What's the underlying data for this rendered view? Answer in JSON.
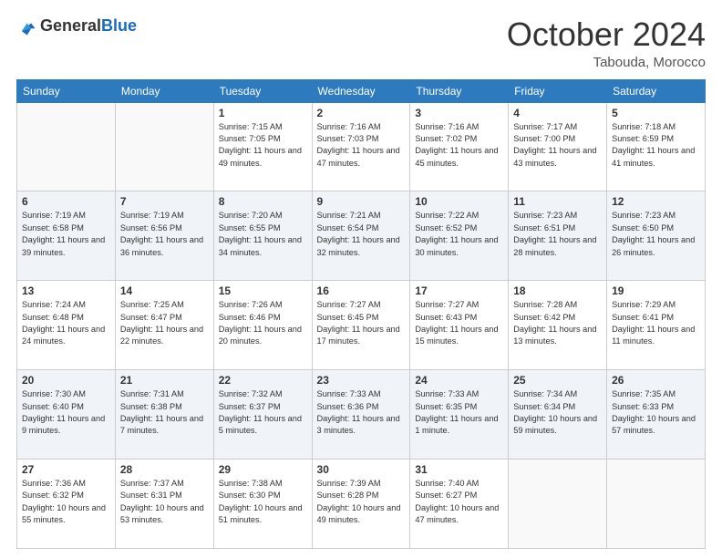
{
  "logo": {
    "general": "General",
    "blue": "Blue"
  },
  "header": {
    "month": "October 2024",
    "location": "Tabouda, Morocco"
  },
  "days_of_week": [
    "Sunday",
    "Monday",
    "Tuesday",
    "Wednesday",
    "Thursday",
    "Friday",
    "Saturday"
  ],
  "weeks": [
    [
      {
        "day": "",
        "sunrise": "",
        "sunset": "",
        "daylight": "",
        "empty": true
      },
      {
        "day": "",
        "sunrise": "",
        "sunset": "",
        "daylight": "",
        "empty": true
      },
      {
        "day": "1",
        "sunrise": "Sunrise: 7:15 AM",
        "sunset": "Sunset: 7:05 PM",
        "daylight": "Daylight: 11 hours and 49 minutes."
      },
      {
        "day": "2",
        "sunrise": "Sunrise: 7:16 AM",
        "sunset": "Sunset: 7:03 PM",
        "daylight": "Daylight: 11 hours and 47 minutes."
      },
      {
        "day": "3",
        "sunrise": "Sunrise: 7:16 AM",
        "sunset": "Sunset: 7:02 PM",
        "daylight": "Daylight: 11 hours and 45 minutes."
      },
      {
        "day": "4",
        "sunrise": "Sunrise: 7:17 AM",
        "sunset": "Sunset: 7:00 PM",
        "daylight": "Daylight: 11 hours and 43 minutes."
      },
      {
        "day": "5",
        "sunrise": "Sunrise: 7:18 AM",
        "sunset": "Sunset: 6:59 PM",
        "daylight": "Daylight: 11 hours and 41 minutes."
      }
    ],
    [
      {
        "day": "6",
        "sunrise": "Sunrise: 7:19 AM",
        "sunset": "Sunset: 6:58 PM",
        "daylight": "Daylight: 11 hours and 39 minutes."
      },
      {
        "day": "7",
        "sunrise": "Sunrise: 7:19 AM",
        "sunset": "Sunset: 6:56 PM",
        "daylight": "Daylight: 11 hours and 36 minutes."
      },
      {
        "day": "8",
        "sunrise": "Sunrise: 7:20 AM",
        "sunset": "Sunset: 6:55 PM",
        "daylight": "Daylight: 11 hours and 34 minutes."
      },
      {
        "day": "9",
        "sunrise": "Sunrise: 7:21 AM",
        "sunset": "Sunset: 6:54 PM",
        "daylight": "Daylight: 11 hours and 32 minutes."
      },
      {
        "day": "10",
        "sunrise": "Sunrise: 7:22 AM",
        "sunset": "Sunset: 6:52 PM",
        "daylight": "Daylight: 11 hours and 30 minutes."
      },
      {
        "day": "11",
        "sunrise": "Sunrise: 7:23 AM",
        "sunset": "Sunset: 6:51 PM",
        "daylight": "Daylight: 11 hours and 28 minutes."
      },
      {
        "day": "12",
        "sunrise": "Sunrise: 7:23 AM",
        "sunset": "Sunset: 6:50 PM",
        "daylight": "Daylight: 11 hours and 26 minutes."
      }
    ],
    [
      {
        "day": "13",
        "sunrise": "Sunrise: 7:24 AM",
        "sunset": "Sunset: 6:48 PM",
        "daylight": "Daylight: 11 hours and 24 minutes."
      },
      {
        "day": "14",
        "sunrise": "Sunrise: 7:25 AM",
        "sunset": "Sunset: 6:47 PM",
        "daylight": "Daylight: 11 hours and 22 minutes."
      },
      {
        "day": "15",
        "sunrise": "Sunrise: 7:26 AM",
        "sunset": "Sunset: 6:46 PM",
        "daylight": "Daylight: 11 hours and 20 minutes."
      },
      {
        "day": "16",
        "sunrise": "Sunrise: 7:27 AM",
        "sunset": "Sunset: 6:45 PM",
        "daylight": "Daylight: 11 hours and 17 minutes."
      },
      {
        "day": "17",
        "sunrise": "Sunrise: 7:27 AM",
        "sunset": "Sunset: 6:43 PM",
        "daylight": "Daylight: 11 hours and 15 minutes."
      },
      {
        "day": "18",
        "sunrise": "Sunrise: 7:28 AM",
        "sunset": "Sunset: 6:42 PM",
        "daylight": "Daylight: 11 hours and 13 minutes."
      },
      {
        "day": "19",
        "sunrise": "Sunrise: 7:29 AM",
        "sunset": "Sunset: 6:41 PM",
        "daylight": "Daylight: 11 hours and 11 minutes."
      }
    ],
    [
      {
        "day": "20",
        "sunrise": "Sunrise: 7:30 AM",
        "sunset": "Sunset: 6:40 PM",
        "daylight": "Daylight: 11 hours and 9 minutes."
      },
      {
        "day": "21",
        "sunrise": "Sunrise: 7:31 AM",
        "sunset": "Sunset: 6:38 PM",
        "daylight": "Daylight: 11 hours and 7 minutes."
      },
      {
        "day": "22",
        "sunrise": "Sunrise: 7:32 AM",
        "sunset": "Sunset: 6:37 PM",
        "daylight": "Daylight: 11 hours and 5 minutes."
      },
      {
        "day": "23",
        "sunrise": "Sunrise: 7:33 AM",
        "sunset": "Sunset: 6:36 PM",
        "daylight": "Daylight: 11 hours and 3 minutes."
      },
      {
        "day": "24",
        "sunrise": "Sunrise: 7:33 AM",
        "sunset": "Sunset: 6:35 PM",
        "daylight": "Daylight: 11 hours and 1 minute."
      },
      {
        "day": "25",
        "sunrise": "Sunrise: 7:34 AM",
        "sunset": "Sunset: 6:34 PM",
        "daylight": "Daylight: 10 hours and 59 minutes."
      },
      {
        "day": "26",
        "sunrise": "Sunrise: 7:35 AM",
        "sunset": "Sunset: 6:33 PM",
        "daylight": "Daylight: 10 hours and 57 minutes."
      }
    ],
    [
      {
        "day": "27",
        "sunrise": "Sunrise: 7:36 AM",
        "sunset": "Sunset: 6:32 PM",
        "daylight": "Daylight: 10 hours and 55 minutes."
      },
      {
        "day": "28",
        "sunrise": "Sunrise: 7:37 AM",
        "sunset": "Sunset: 6:31 PM",
        "daylight": "Daylight: 10 hours and 53 minutes."
      },
      {
        "day": "29",
        "sunrise": "Sunrise: 7:38 AM",
        "sunset": "Sunset: 6:30 PM",
        "daylight": "Daylight: 10 hours and 51 minutes."
      },
      {
        "day": "30",
        "sunrise": "Sunrise: 7:39 AM",
        "sunset": "Sunset: 6:28 PM",
        "daylight": "Daylight: 10 hours and 49 minutes."
      },
      {
        "day": "31",
        "sunrise": "Sunrise: 7:40 AM",
        "sunset": "Sunset: 6:27 PM",
        "daylight": "Daylight: 10 hours and 47 minutes."
      },
      {
        "day": "",
        "sunrise": "",
        "sunset": "",
        "daylight": "",
        "empty": true
      },
      {
        "day": "",
        "sunrise": "",
        "sunset": "",
        "daylight": "",
        "empty": true
      }
    ]
  ]
}
